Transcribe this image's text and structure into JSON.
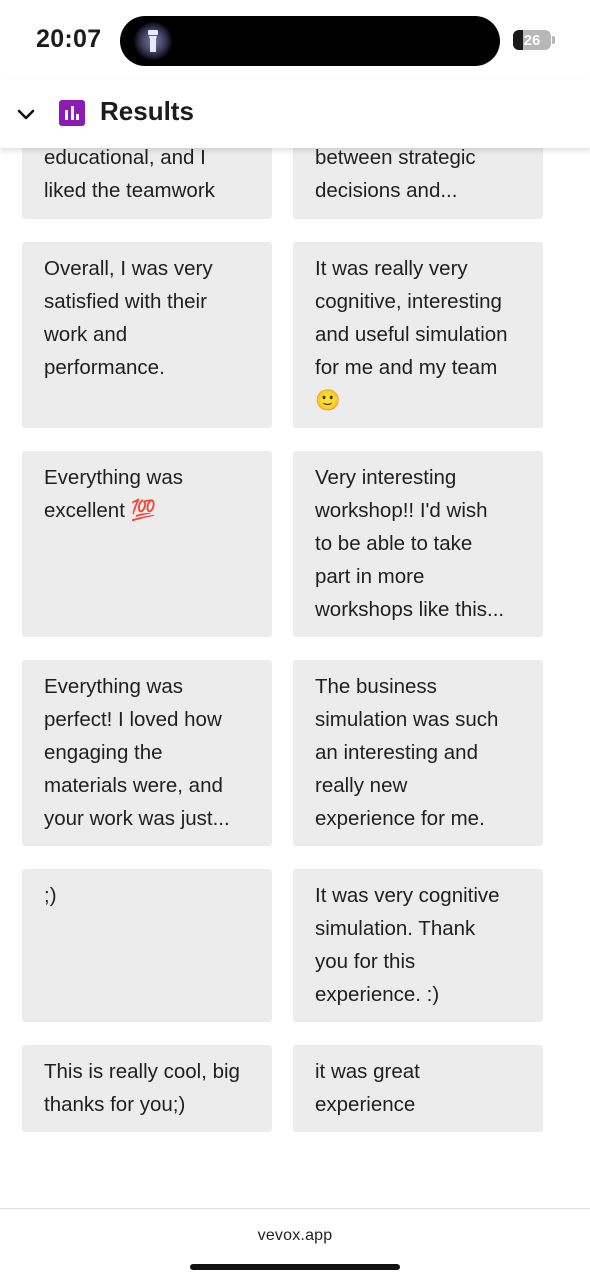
{
  "status_bar": {
    "time": "20:07",
    "battery_level": "26",
    "battery_fraction": 0.26
  },
  "header": {
    "title": "Results",
    "accent_color": "#8c1bb5"
  },
  "responses": [
    {
      "text": "educational, and I\nliked the teamwork"
    },
    {
      "text": "between strategic\ndecisions and..."
    },
    {
      "text": "Overall, I was very\nsatisfied with their\nwork and\nperformance."
    },
    {
      "text": "It was really very\ncognitive, interesting\nand useful simulation\nfor me and my team\n🙂"
    },
    {
      "text": "Everything was\nexcellent 💯"
    },
    {
      "text": "Very interesting\nworkshop!! I'd wish\nto be able to take\npart in more\nworkshops like this..."
    },
    {
      "text": "Everything was\nperfect! I loved how\nengaging the\nmaterials were, and\nyour work was just..."
    },
    {
      "text": "The business\nsimulation was such\nan interesting and\nreally new\nexperience for me."
    },
    {
      "text": ";)"
    },
    {
      "text": "It was very cognitive\nsimulation. Thank\nyou for this\nexperience. :)"
    },
    {
      "text": "This is really cool, big\nthanks for you;)"
    },
    {
      "text": "it was great\nexperience"
    }
  ],
  "browser": {
    "url": "vevox.app"
  }
}
